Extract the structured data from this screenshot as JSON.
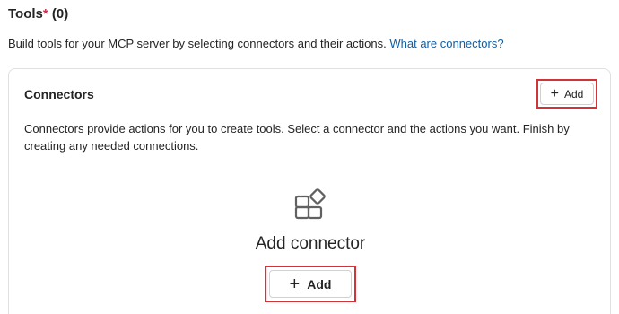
{
  "section": {
    "title": "Tools",
    "required_mark": "*",
    "count": "(0)",
    "description": "Build tools for your MCP server by selecting connectors and their actions.",
    "link_text": "What are connectors?"
  },
  "connectors_card": {
    "title": "Connectors",
    "add_button_label": "Add",
    "description": "Connectors provide actions for you to create tools. Select a connector and the actions you want. Finish by creating any needed connections.",
    "empty_state": {
      "icon": "apps-add-icon",
      "label": "Add connector",
      "add_button_label": "Add"
    }
  },
  "colors": {
    "highlight_border": "#d13438",
    "link": "#115ea3",
    "required": "#c4314b"
  }
}
